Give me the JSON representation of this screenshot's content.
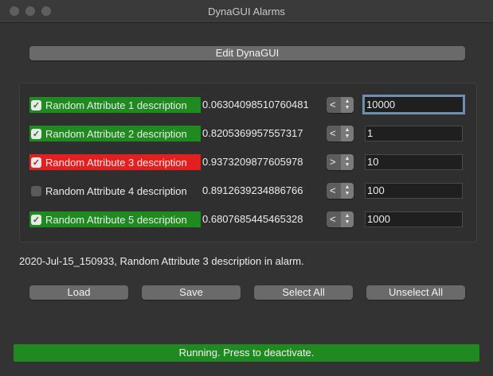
{
  "window": {
    "title": "DynaGUI Alarms"
  },
  "edit_button": "Edit DynaGUI",
  "rows": [
    {
      "label": "Random Attribute 1 description",
      "value": "0.06304098510760481",
      "comparator": "<",
      "threshold": "10000",
      "checked": true,
      "state": "ok"
    },
    {
      "label": "Random Attribute 2 description",
      "value": "0.8205369957557317",
      "comparator": "<",
      "threshold": "1",
      "checked": true,
      "state": "ok"
    },
    {
      "label": "Random Attribute 3 description",
      "value": "0.9373209877605978",
      "comparator": ">",
      "threshold": "10",
      "checked": true,
      "state": "alarm"
    },
    {
      "label": "Random Attribute 4 description",
      "value": "0.8912639234886766",
      "comparator": "<",
      "threshold": "100",
      "checked": false,
      "state": "none"
    },
    {
      "label": "Random Attribute 5 description",
      "value": "0.6807685445465328",
      "comparator": "<",
      "threshold": "1000",
      "checked": true,
      "state": "ok"
    }
  ],
  "status_message": "2020-Jul-15_150933, Random Attribute 3 description in alarm.",
  "buttons": {
    "load": "Load",
    "save": "Save",
    "select_all": "Select All",
    "unselect_all": "Unselect All"
  },
  "running_label": "Running. Press to deactivate.",
  "colors": {
    "ok": "#1f8a1f",
    "alarm": "#e41f1f",
    "running": "#1f8a1f"
  }
}
